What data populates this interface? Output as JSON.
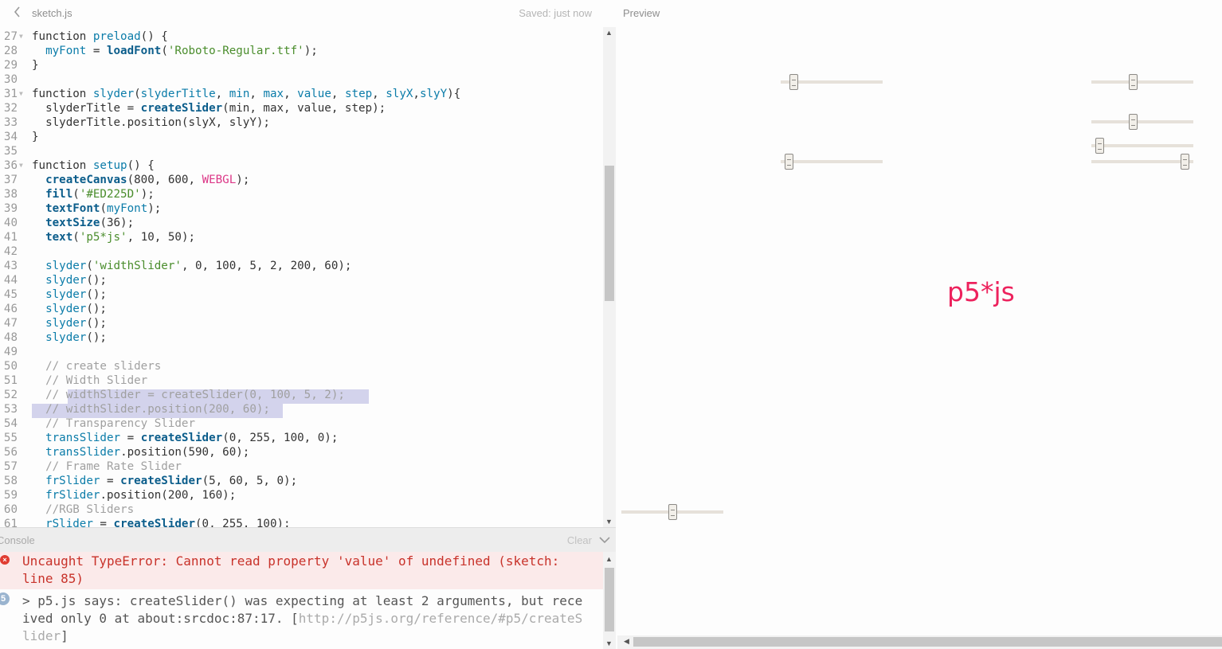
{
  "editor": {
    "file_name": "sketch.js",
    "saved_status": "Saved: just now",
    "back_icon": "chevron-left-icon"
  },
  "preview": {
    "label": "Preview",
    "canvas_text": "p5*js",
    "canvas_text_color": "#ED225D",
    "sliders": [
      {
        "value": 0.09
      },
      {
        "value": 0.4
      },
      {
        "value": 0.4
      },
      {
        "value": 0.04
      },
      {
        "value": 0.04
      },
      {
        "value": 0.96
      },
      {
        "value": 0.5
      }
    ]
  },
  "code_lines": [
    {
      "n": "27",
      "fold": true
    },
    {
      "n": "28"
    },
    {
      "n": "29"
    },
    {
      "n": "30"
    },
    {
      "n": "31",
      "fold": true
    },
    {
      "n": "32"
    },
    {
      "n": "33"
    },
    {
      "n": "34"
    },
    {
      "n": "35"
    },
    {
      "n": "36",
      "fold": true
    },
    {
      "n": "37"
    },
    {
      "n": "38"
    },
    {
      "n": "39"
    },
    {
      "n": "40"
    },
    {
      "n": "41"
    },
    {
      "n": "42"
    },
    {
      "n": "43"
    },
    {
      "n": "44"
    },
    {
      "n": "45"
    },
    {
      "n": "46"
    },
    {
      "n": "47"
    },
    {
      "n": "48"
    },
    {
      "n": "49"
    },
    {
      "n": "50"
    },
    {
      "n": "51"
    },
    {
      "n": "52"
    },
    {
      "n": "53"
    },
    {
      "n": "54"
    },
    {
      "n": "55"
    },
    {
      "n": "56"
    },
    {
      "n": "57"
    },
    {
      "n": "58"
    },
    {
      "n": "59"
    },
    {
      "n": "60"
    },
    {
      "n": "61"
    }
  ],
  "code": {
    "l27": [
      "function ",
      "preload",
      "() {"
    ],
    "l28": [
      "  ",
      "myFont",
      " = ",
      "loadFont",
      "(",
      "'Roboto-Regular.ttf'",
      ");"
    ],
    "l29": [
      "}"
    ],
    "l31": [
      "function ",
      "slyder",
      "(",
      "slyderTitle",
      ", ",
      "min",
      ", ",
      "max",
      ", ",
      "value",
      ", ",
      "step",
      ", ",
      "slyX",
      ",",
      "slyY",
      "){"
    ],
    "l32": [
      "  slyderTitle = ",
      "createSlider",
      "(min, max, value, step);"
    ],
    "l33": [
      "  slyderTitle.position(slyX, slyY);"
    ],
    "l34": [
      "}"
    ],
    "l36": [
      "function ",
      "setup",
      "() {"
    ],
    "l37": [
      "  ",
      "createCanvas",
      "(800, 600, ",
      "WEBGL",
      ");"
    ],
    "l38": [
      "  ",
      "fill",
      "(",
      "'#ED225D'",
      ");"
    ],
    "l39": [
      "  ",
      "textFont",
      "(",
      "myFont",
      ");"
    ],
    "l40": [
      "  ",
      "textSize",
      "(36);"
    ],
    "l41": [
      "  ",
      "text",
      "(",
      "'p5*js'",
      ", 10, 50);"
    ],
    "l43": [
      "  ",
      "slyder",
      "(",
      "'widthSlider'",
      ", 0, 100, 5, 2, 200, 60);"
    ],
    "l44": [
      "  ",
      "slyder",
      "();"
    ],
    "l45": [
      "  ",
      "slyder",
      "();"
    ],
    "l46": [
      "  ",
      "slyder",
      "();"
    ],
    "l47": [
      "  ",
      "slyder",
      "();"
    ],
    "l48": [
      "  ",
      "slyder",
      "();"
    ],
    "l50": [
      "  // create sliders"
    ],
    "l51": [
      "  // Width Slider"
    ],
    "l52a": [
      "  // "
    ],
    "l52b": [
      "widthSlider = createSlider(0, 100, 5, 2);"
    ],
    "l53": [
      "  // widthSlider.position(200, 60);"
    ],
    "l54": [
      "  // Transparency Slider"
    ],
    "l55": [
      "  ",
      "transSlider",
      " = ",
      "createSlider",
      "(0, 255, 100, 0);"
    ],
    "l56": [
      "  ",
      "transSlider",
      ".position(590, 60);"
    ],
    "l57": [
      "  // Frame Rate Slider"
    ],
    "l58": [
      "  ",
      "frSlider",
      " = ",
      "createSlider",
      "(5, 60, 5, 0);"
    ],
    "l59": [
      "  ",
      "frSlider",
      ".position(200, 160);"
    ],
    "l60": [
      "  //RGB Sliders"
    ],
    "l61": [
      "  ",
      "rSlider",
      " = ",
      "createSlider",
      "(0, 255, 100);"
    ]
  },
  "console": {
    "title": "Console",
    "clear_label": "Clear",
    "error_icon": "error-icon",
    "error_message": "Uncaught TypeError: Cannot read property 'value' of undefined (sketch: line 85)",
    "info_icon": "p5-info-icon",
    "info_icon_label": "5",
    "info_message": "> p5.js says: createSlider() was expecting at least 2 arguments, but received only 0 at about:srcdoc:87:17. [",
    "info_link": "http://p5js.org/reference/#p5/createSlider",
    "info_close": "]"
  }
}
